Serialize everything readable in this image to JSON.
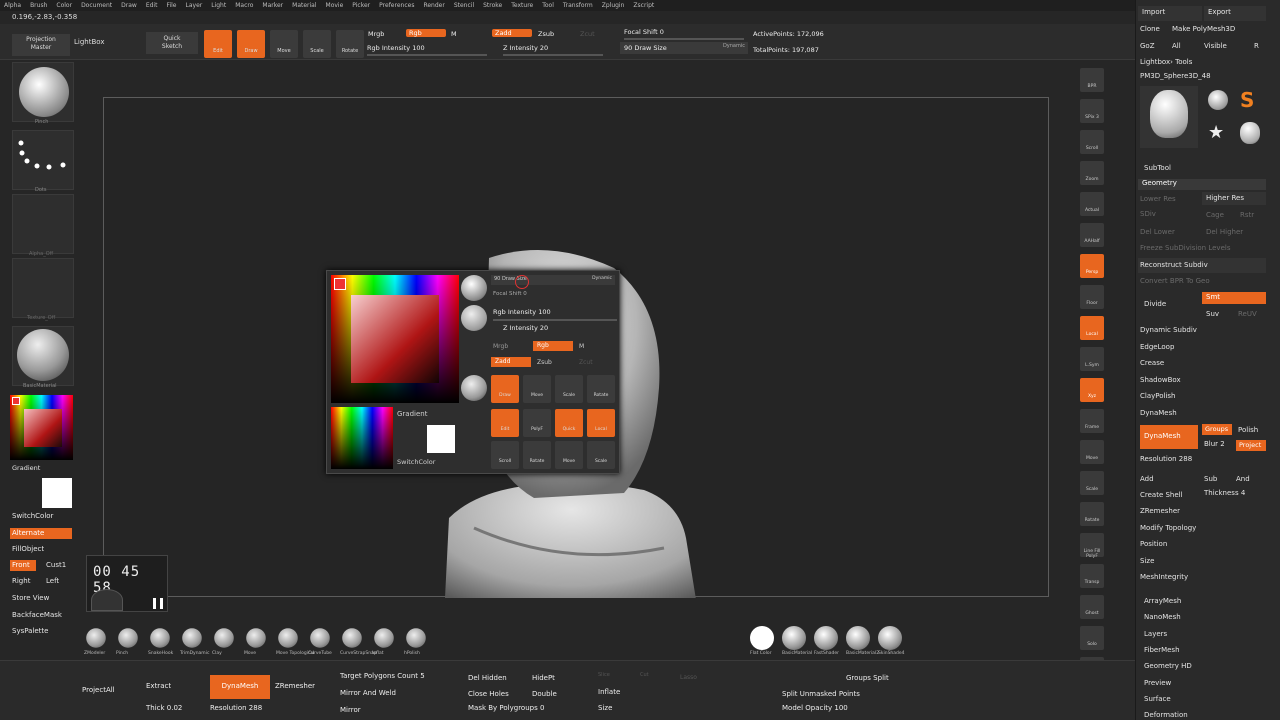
{
  "menubar": [
    "Alpha",
    "Brush",
    "Color",
    "Document",
    "Draw",
    "Edit",
    "File",
    "Layer",
    "Light",
    "Macro",
    "Marker",
    "Material",
    "Movie",
    "Picker",
    "Preferences",
    "Render",
    "Stencil",
    "Stroke",
    "Texture",
    "Tool",
    "Transform",
    "Zplugin",
    "Zscript"
  ],
  "coords": "0.196,-2.83,-0.358",
  "topbar": {
    "projection_master": "Projection\nMaster",
    "lightbox": "LightBox",
    "quick_sketch": "Quick\nSketch",
    "edit": "Edit",
    "draw": "Draw",
    "move": "Move",
    "scale": "Scale",
    "rotate": "Rotate",
    "mrgb": "Mrgb",
    "rgb": "Rgb",
    "m": "M",
    "rgb_intensity": "Rgb Intensity 100",
    "zadd": "Zadd",
    "zsub": "Zsub",
    "zcut": "Zcut",
    "z_intensity": "Z Intensity 20",
    "focal_shift": "Focal Shift 0",
    "draw_size": "90 Draw Size",
    "dynamic": "Dynamic",
    "active_points": "ActivePoints: 172,096",
    "total_points": "TotalPoints: 197,087"
  },
  "leftbar": {
    "pinch": "Pinch",
    "dots": "Dots",
    "alpha_off": "Alpha_Off",
    "texture_off": "Texture_Off",
    "basic_material": "BasicMaterial",
    "gradient": "Gradient",
    "switch_color": "SwitchColor",
    "alternate": "Alternate",
    "fill_object": "FillObject",
    "front": "Front",
    "cust1": "Cust1",
    "right": "Right",
    "left": "Left",
    "store_view": "Store View",
    "backface_mask": "BackfaceMask",
    "sys_palette": "SysPalette"
  },
  "timer": {
    "display": "00 45 58"
  },
  "picker": {
    "draw_size": "90 Draw Size",
    "dynamic": "Dynamic",
    "focal_shift": "Focal Shift 0",
    "rgb_intensity": "Rgb Intensity 100",
    "z_intensity": "Z Intensity 20",
    "mrgb": "Mrgb",
    "rgb": "Rgb",
    "m": "M",
    "zadd": "Zadd",
    "zsub": "Zsub",
    "zcut": "Zcut",
    "gradient": "Gradient",
    "switch_color": "SwitchColor",
    "draw": "Draw",
    "move": "Move",
    "scale": "Scale",
    "rotate": "Rotate",
    "edit": "Edit",
    "polyf": "PolyF",
    "quick": "Quick",
    "local": "Local",
    "scroll": "Scroll",
    "zoom": "Rotate",
    "frame": "Move",
    "scale2": "Scale",
    "pinch": "Pinch",
    "dots": "Dots",
    "alpha": "Alpha_Off",
    "texture": "Texture_Off",
    "basic": "BasicMaterial"
  },
  "right_shelf": [
    "BPR",
    "SPix 3",
    "Scroll",
    "Zoom",
    "Actual",
    "AAHalf",
    "Persp",
    "Floor",
    "Local",
    "L.Sym",
    "Xyz",
    "Frame",
    "Move",
    "Scale",
    "Rotate",
    "Line Fill PolyF",
    "Transp",
    "Ghost",
    "Solo",
    "Xpose"
  ],
  "tray": {
    "import": "Import",
    "export": "Export",
    "clone": "Clone",
    "make_polymesh": "Make PolyMesh3D",
    "goz": "GoZ",
    "all": "All",
    "visible": "Visible",
    "r": "R",
    "lightbox_tools": "Lightbox› Tools",
    "pm3d_sphere": "PM3D_Sphere3D_48",
    "subtool": "SubTool",
    "geometry": "Geometry",
    "lower_res": "Lower Res",
    "higher_res": "Higher Res",
    "sdiv": "SDiv",
    "cage": "Cage",
    "rstr": "Rstr",
    "del_lower": "Del Lower",
    "del_higher": "Del Higher",
    "freeze": "Freeze SubDivision Levels",
    "reconstruct": "Reconstruct Subdiv",
    "convert_bpr": "Convert BPR To Geo",
    "divide": "Divide",
    "smt": "Smt",
    "suv": "Suv",
    "reuv": "ReUV",
    "dynamic_subdiv": "Dynamic Subdiv",
    "edgeloop": "EdgeLoop",
    "crease": "Crease",
    "shadowbox": "ShadowBox",
    "claypolish": "ClayPolish",
    "dynamesh_hdr": "DynaMesh",
    "dynamesh_btn": "DynaMesh",
    "groups": "Groups",
    "polish": "Polish",
    "blur": "Blur 2",
    "project": "Project",
    "resolution": "Resolution 288",
    "add": "Add",
    "sub": "Sub",
    "and": "And",
    "create_shell": "Create Shell",
    "thickness": "Thickness 4",
    "zremesher": "ZRemesher",
    "modify_topology": "Modify Topology",
    "position": "Position",
    "size": "Size",
    "mesh_integrity": "MeshIntegrity",
    "arraymesh": "ArrayMesh",
    "nanomesh": "NanoMesh",
    "layers": "Layers",
    "fibermesh": "FiberMesh",
    "geometry_hd": "Geometry HD",
    "preview": "Preview",
    "surface": "Surface",
    "deformation": "Deformation"
  },
  "brushes": [
    "ZModeler",
    "Pinch",
    "SnakeHook",
    "TrimDynamic",
    "Clay",
    "Move",
    "Move Topological",
    "CurveTube",
    "CurveStrapSnap",
    "Inflat",
    "hPolish"
  ],
  "materials": [
    "Flat Color",
    "BasicMaterial",
    "FastShader",
    "BasicMaterial2",
    "SkinShade4"
  ],
  "bottombar": {
    "project_all": "ProjectAll",
    "extract": "Extract",
    "dynamesh": "DynaMesh",
    "zremesher": "ZRemesher",
    "thick": "Thick 0.02",
    "resolution": "Resolution 288",
    "target_polygons": "Target Polygons Count 5",
    "mirror_and_weld": "Mirror And Weld",
    "mirror": "Mirror",
    "del_hidden": "Del Hidden",
    "close_holes": "Close Holes",
    "mask_by_polygroups": "Mask By Polygroups 0",
    "hide_pt": "HidePt",
    "double": "Double",
    "inflate": "Inflate",
    "size": "Size",
    "slice": "Slice",
    "cut": "Cut",
    "lasso": "Lasso",
    "groups_split": "Groups Split",
    "split_unmasked": "Split Unmasked Points",
    "model_opacity": "Model Opacity 100"
  }
}
